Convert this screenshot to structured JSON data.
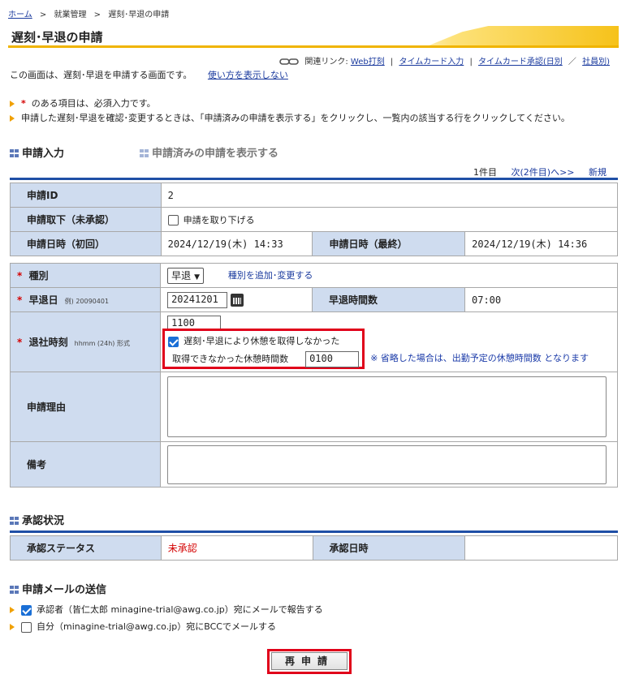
{
  "breadcrumb": {
    "home": "ホーム",
    "sep": ">",
    "level2": "就業管理",
    "current": "遅刻･早退の申請"
  },
  "page": {
    "title": "遅刻･早退の申請"
  },
  "related": {
    "label": "関連リンク:",
    "links": [
      "Web打刻",
      "タイムカード入力",
      "タイムカード承認(日別",
      "社員別)"
    ],
    "separator": "|",
    "slash": "／"
  },
  "intro": {
    "text": "この画面は、遅刻･早退を申請する画面です。",
    "help_link": "使い方を表示しない"
  },
  "notes": {
    "required_suffix": "のある項目は、必須入力です。",
    "required_mark": "*",
    "edit_note": "申請した遅刻･早退を確認･変更するときは、「申請済みの申請を表示する」をクリックし、一覧内の該当する行をクリックしてください。"
  },
  "sections": {
    "input": "申請入力",
    "show_submitted": "申請済みの申請を表示する",
    "approval": "承認状況",
    "mail": "申請メールの送信"
  },
  "navinfo": {
    "count": "1件目",
    "next": "次(2件目)へ>>",
    "new": "新規"
  },
  "info_table": {
    "id_label": "申請ID",
    "id_value": "2",
    "withdraw_label": "申請取下（未承認）",
    "withdraw_checkbox": "申請を取り下げる",
    "first_label": "申請日時（初回）",
    "first_value": "2024/12/19(木) 14:33",
    "last_label": "申請日時（最終）",
    "last_value": "2024/12/19(木) 14:36"
  },
  "form": {
    "type_label": "種別",
    "type_value": "早退",
    "type_link": "種別を追加･変更する",
    "date_label": "早退日",
    "date_hint": "例) 20090401",
    "date_value": "20241201",
    "hours_label": "早退時間数",
    "hours_value": "07:00",
    "time_label": "退社時刻",
    "time_hint": "hhmm (24h) 形式",
    "time_value": "1100",
    "no_break_checkbox": "遅刻･早退により休憩を取得しなかった",
    "break_label": "取得できなかった休憩時間数",
    "break_value": "0100",
    "break_note": "※ 省略した場合は、出勤予定の休憩時間数 となります",
    "reason_label": "申請理由",
    "reason_value": "",
    "remarks_label": "備考",
    "remarks_value": ""
  },
  "approval": {
    "status_label": "承認ステータス",
    "status_value": "未承認",
    "date_label": "承認日時",
    "date_value": ""
  },
  "mail": {
    "approver": "承認者（皆仁太郎 minagine-trial@awg.co.jp）宛にメールで報告する",
    "self": "自分（minagine-trial@awg.co.jp）宛にBCCでメールする"
  },
  "submit_label": "再申請",
  "colors": {
    "accent_yellow": "#f0b400",
    "label_bg": "#cfdcef",
    "header_blue": "#1f4fa6",
    "highlight_red": "#e0001a",
    "status_red": "#d40000"
  }
}
